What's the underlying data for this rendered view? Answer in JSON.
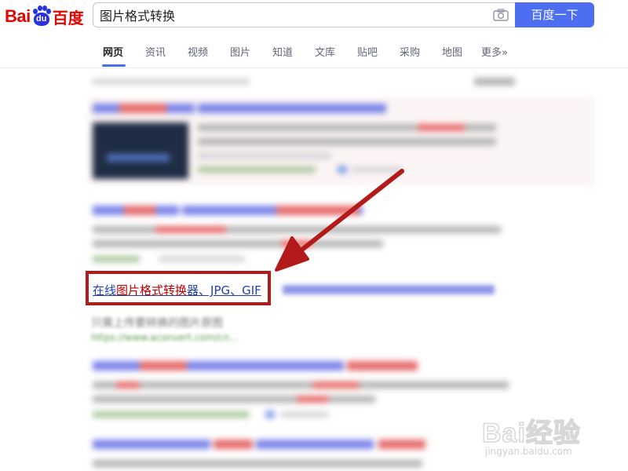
{
  "header": {
    "logo": {
      "latin": "Bai",
      "paw": "du",
      "chinese": "百度"
    },
    "search": {
      "value": "图片格式转换",
      "button_label": "百度一下"
    }
  },
  "nav": {
    "tabs": [
      {
        "label": "网页",
        "active": true
      },
      {
        "label": "资讯",
        "active": false
      },
      {
        "label": "视频",
        "active": false
      },
      {
        "label": "图片",
        "active": false
      },
      {
        "label": "知道",
        "active": false
      },
      {
        "label": "文库",
        "active": false
      },
      {
        "label": "贴吧",
        "active": false
      },
      {
        "label": "采购",
        "active": false
      },
      {
        "label": "地图",
        "active": false
      },
      {
        "label": "更多»",
        "active": false
      }
    ]
  },
  "highlighted_result": {
    "title_prefix": "在线",
    "title_keyword": "图片格式转换",
    "title_suffix": "器、JPG、GIF",
    "snippet": "只需上传要转换的图片原图",
    "url": "https://www.aconvert.com/cn..."
  },
  "annotation": {
    "box_color": "#b31b1b",
    "arrow_color": "#b31b1b"
  },
  "watermark": {
    "brand": "Bai经验",
    "domain": "jingyan.baidu.com"
  },
  "colors": {
    "accent": "#4e6ef2",
    "link": "#2440b3",
    "keyword": "#c00000",
    "logo_red": "#e10601",
    "logo_blue": "#2932e1"
  }
}
